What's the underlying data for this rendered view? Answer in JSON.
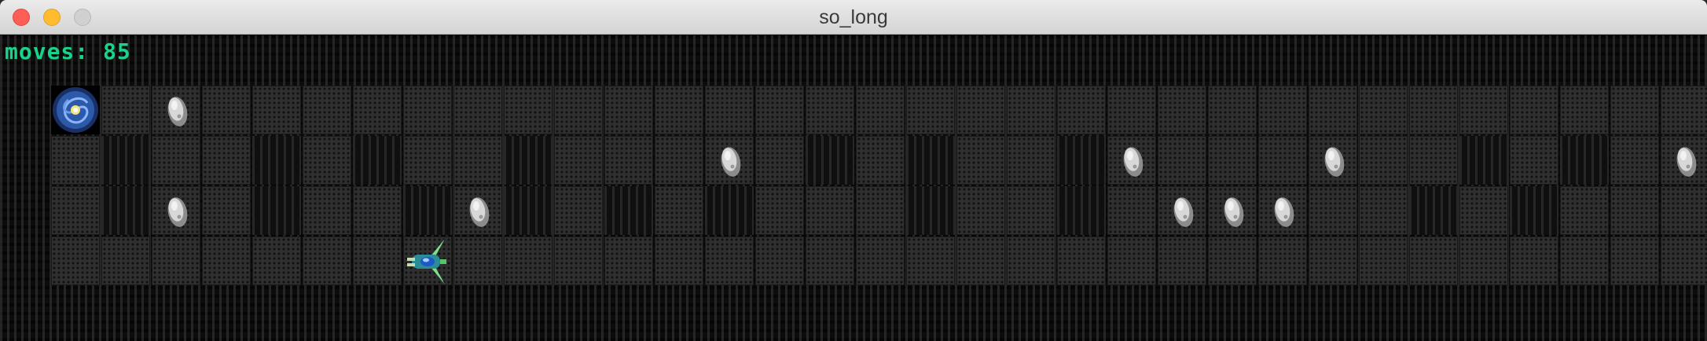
{
  "window": {
    "title": "so_long",
    "buttons": [
      "close",
      "minimize",
      "maximize"
    ]
  },
  "hud": {
    "moves_text": "moves: 85"
  },
  "colors": {
    "hud_text": "#19d38a",
    "floor": "#2f2f2f",
    "wall": "#0f0f0f"
  },
  "map": {
    "rows": [
      "EF0FFFFFFFFFFFFFFFFFFFFFFFFFFFFFFFF",
      "FWFFWFWFFWFFF0FWFWFFWC FFFCFFWFWFC",
      "FWCFWFFWC WFWFWFFFWFFWF0CCCFFWFWFF",
      "FFFFFFFPFFFFFFFFFFFFFFFFFFFFFFFFFFF"
    ],
    "legend": {
      "E": "exit",
      "C": "collectible",
      "P": "player",
      "F": "floor",
      "W": "wall",
      "0": "collectible"
    }
  }
}
